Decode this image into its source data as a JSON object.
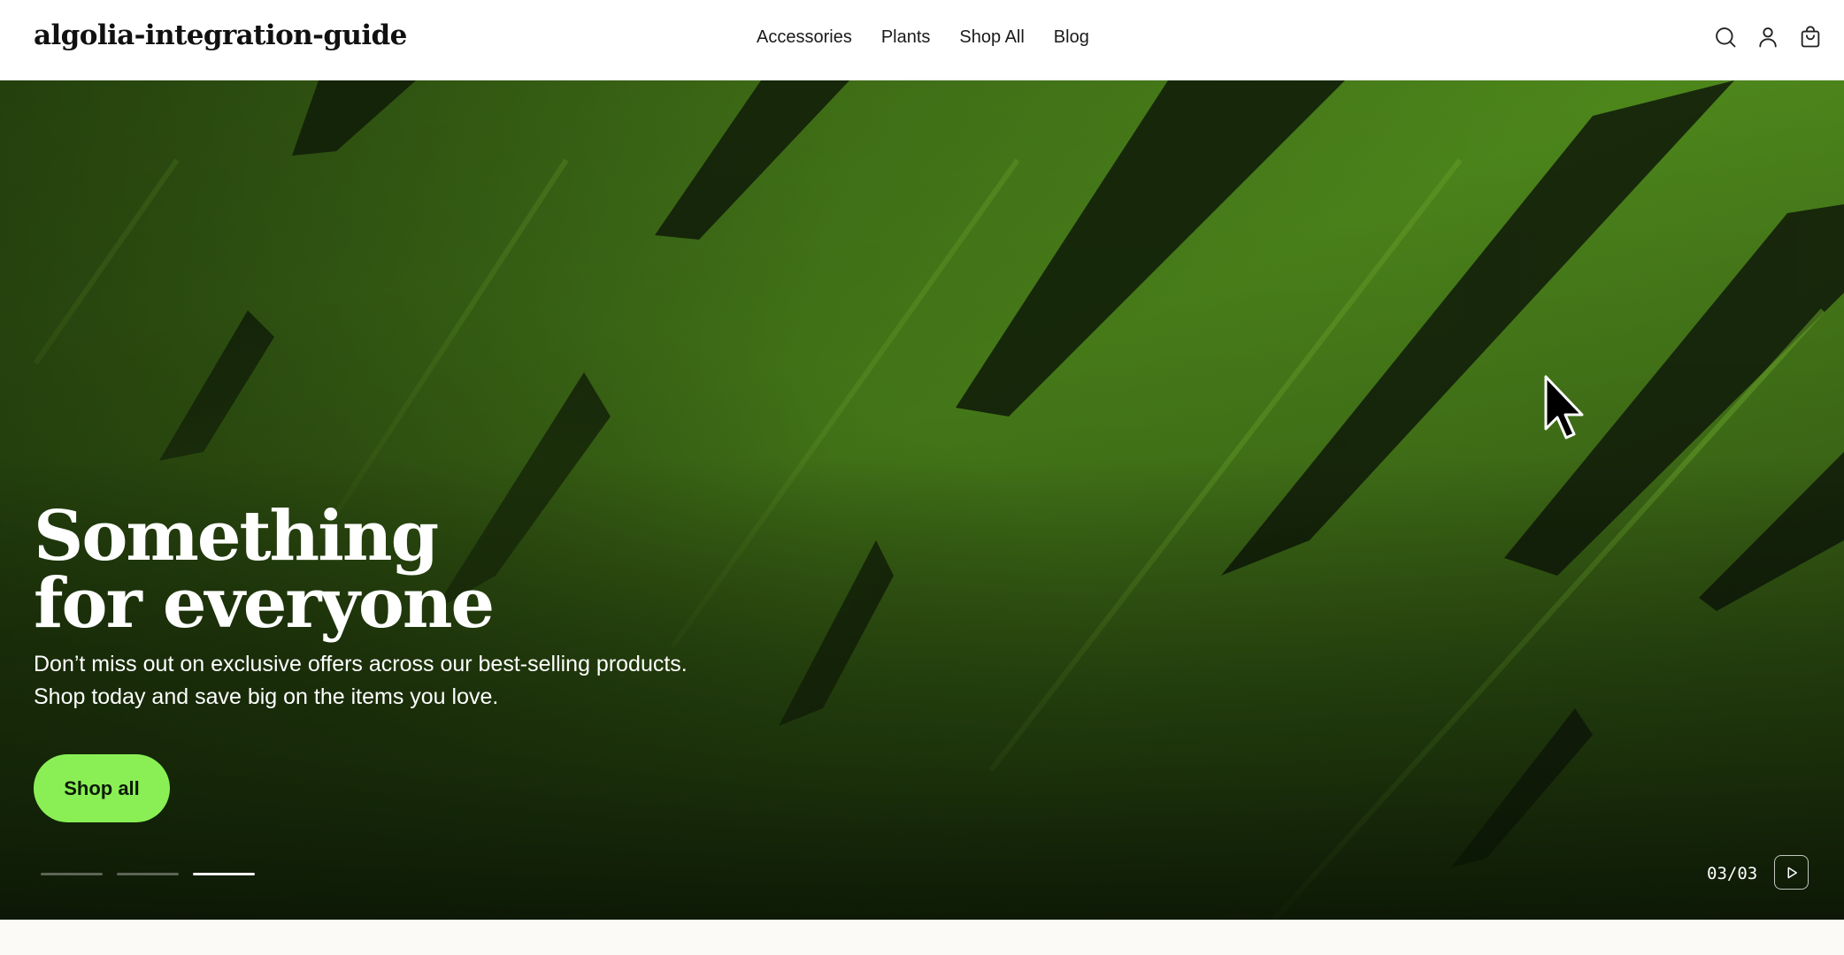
{
  "header": {
    "logo": "algolia-integration-guide",
    "nav": [
      {
        "label": "Accessories"
      },
      {
        "label": "Plants"
      },
      {
        "label": "Shop All"
      },
      {
        "label": "Blog"
      }
    ],
    "icons": [
      "search-icon",
      "account-icon",
      "cart-icon"
    ]
  },
  "hero": {
    "title_line1": "Something",
    "title_line2": "for everyone",
    "subtitle": "Don’t miss out on exclusive offers across our best-selling products. Shop today and save big on the items you love.",
    "cta_label": "Shop all",
    "slide_counter": "03/03",
    "slides_total": 3,
    "active_slide": 3,
    "colors": {
      "cta_background": "#8aef55",
      "leaf_green": "#4f8a1c",
      "text": "#ffffff"
    }
  }
}
